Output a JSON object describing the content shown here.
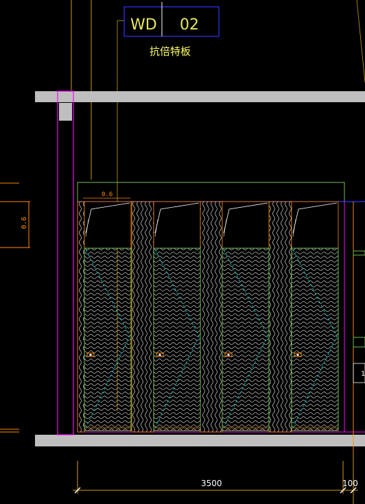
{
  "tag": {
    "code": "WD",
    "number": "02",
    "material": "抗倍特板"
  },
  "dimensions": {
    "overall_width": "3500",
    "right_offset": "100",
    "left_height": "0.6",
    "top_height": "0.6",
    "right_cut_text": "1"
  },
  "colors": {
    "background": "#000000",
    "slab": "#bfbfbf",
    "magenta": "#ff00ff",
    "orange": "#ff8c00",
    "yellow_dim": "#c8a000",
    "dim_line": "#d4a017",
    "blue": "#3333ff",
    "green": "#6fbf4f",
    "wood": "#d8d8d8",
    "cyan": "#00c8c8",
    "text_yellow": "#ffff66",
    "tag_text": "#e8e860",
    "white": "#ffffff"
  },
  "doors": [
    {
      "id": "door-1",
      "handle": "handle-icon"
    },
    {
      "id": "door-2",
      "handle": "handle-icon"
    },
    {
      "id": "door-3",
      "handle": "handle-icon"
    },
    {
      "id": "door-4",
      "handle": "handle-icon"
    }
  ]
}
